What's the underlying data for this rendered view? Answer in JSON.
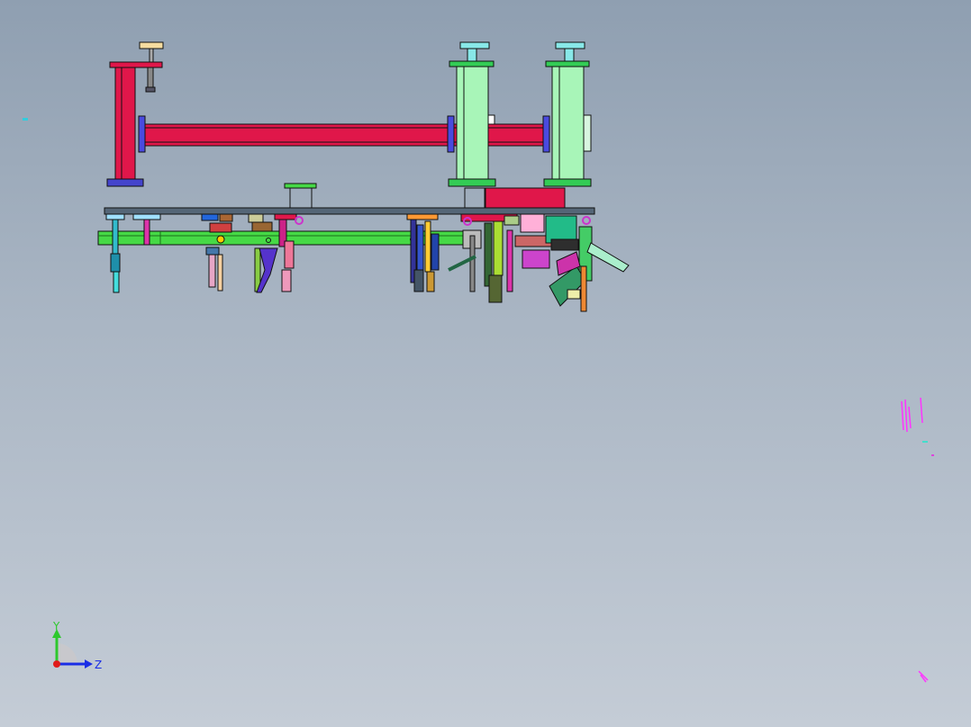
{
  "viewport": {
    "background_top": "#8f9fb1",
    "background_bottom": "#c4ccd6"
  },
  "model": {
    "frame_color": "#e0174a",
    "column_color": "#a8f5b8",
    "rail_color": "#46d946",
    "plate_color": "#556677",
    "outline_color": "#111111"
  },
  "triad": {
    "y_label": "Y",
    "z_label": "Z",
    "y_color": "#2ec82e",
    "z_color": "#1a2ee6",
    "x_color": "#e01a1a"
  }
}
